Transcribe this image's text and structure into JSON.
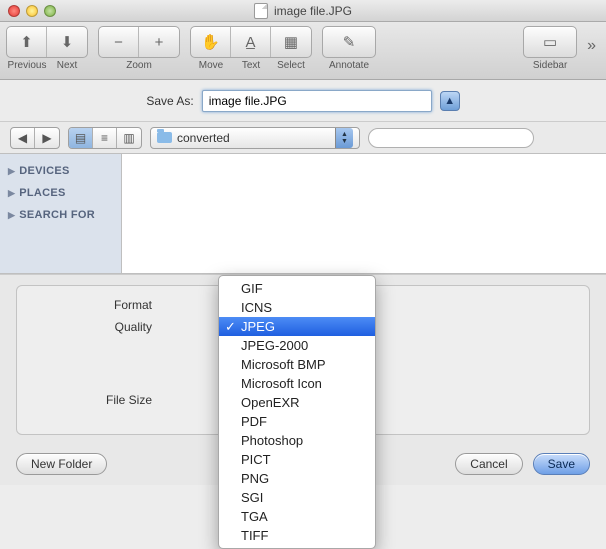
{
  "window": {
    "title": "image file.JPG"
  },
  "toolbar": {
    "previous": "Previous",
    "next": "Next",
    "zoom": "Zoom",
    "move": "Move",
    "text": "Text",
    "select": "Select",
    "annotate": "Annotate",
    "sidebar": "Sidebar"
  },
  "saveas": {
    "label": "Save As:",
    "value": "image file.JPG"
  },
  "browser": {
    "folder": "converted",
    "search_placeholder": ""
  },
  "sidebar": {
    "items": [
      "DEVICES",
      "PLACES",
      "SEARCH FOR"
    ]
  },
  "options": {
    "format_label": "Format",
    "quality_label": "Quality",
    "filesize_label": "File Size"
  },
  "format_menu": {
    "items": [
      "GIF",
      "ICNS",
      "JPEG",
      "JPEG-2000",
      "Microsoft BMP",
      "Microsoft Icon",
      "OpenEXR",
      "PDF",
      "Photoshop",
      "PICT",
      "PNG",
      "SGI",
      "TGA",
      "TIFF"
    ],
    "selected": "JPEG"
  },
  "footer": {
    "newfolder": "New Folder",
    "cancel": "Cancel",
    "save": "Save"
  }
}
